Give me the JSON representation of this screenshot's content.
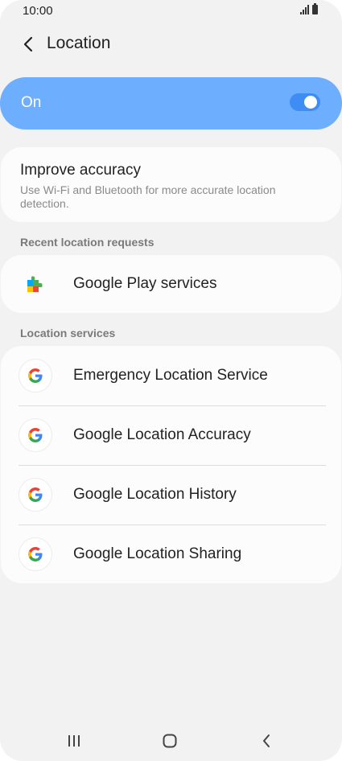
{
  "status_bar": {
    "time": "10:00"
  },
  "header": {
    "title": "Location"
  },
  "master_toggle": {
    "label": "On",
    "enabled": true
  },
  "improve_accuracy": {
    "title": "Improve accuracy",
    "description": "Use Wi-Fi and Bluetooth for more accurate location detection."
  },
  "recent_requests": {
    "heading": "Recent location requests",
    "items": [
      {
        "label": "Google Play services",
        "icon": "google-play-services-icon"
      }
    ]
  },
  "location_services": {
    "heading": "Location services",
    "items": [
      {
        "label": "Emergency Location Service",
        "icon": "google-g-icon"
      },
      {
        "label": "Google Location Accuracy",
        "icon": "google-g-icon"
      },
      {
        "label": "Google Location History",
        "icon": "google-g-icon"
      },
      {
        "label": "Google Location Sharing",
        "icon": "google-g-icon"
      }
    ]
  },
  "colors": {
    "toggle_card": "#6eaeff",
    "switch_on": "#3d8df5",
    "background": "#f2f2f2"
  }
}
